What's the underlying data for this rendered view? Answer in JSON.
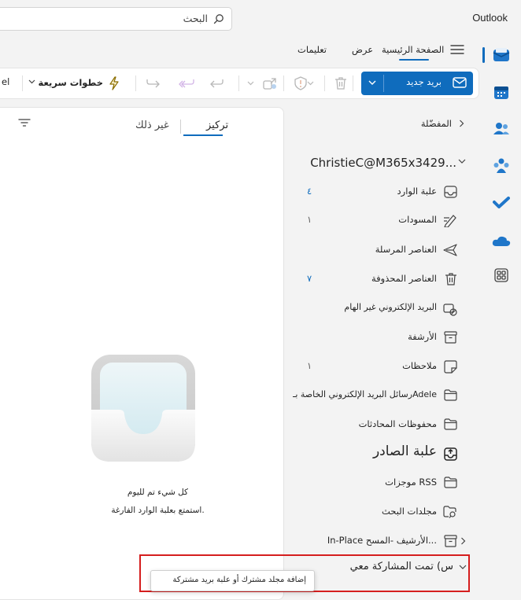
{
  "titlebar": {
    "app_title": "Outlook",
    "search_placeholder": "البحث"
  },
  "ribbon": {
    "tabs": [
      {
        "label": "الصفحة الرئيسية",
        "active": true
      },
      {
        "label": "عرض",
        "active": false
      },
      {
        "label": "تعليمات",
        "active": false
      }
    ]
  },
  "commands": {
    "new_mail_label": "بريد جديد",
    "quick_steps_label": "خطوات سريعة",
    "truncated_label": "el"
  },
  "folders": {
    "favorites_label": "المفضّلة",
    "account_label": "ChristieC@M365x3429...",
    "items": [
      {
        "label": "علبة الوارد",
        "count": "٤",
        "icon": "inbox-icon"
      },
      {
        "label": "المسودات",
        "count": "١",
        "icon": "drafts-icon"
      },
      {
        "label": "العناصر المرسلة",
        "count": "",
        "icon": "sent-icon"
      },
      {
        "label": "العناصر المحذوفة",
        "count": "٧",
        "icon": "trash-icon"
      },
      {
        "label": "البريد الإلكتروني غير الهام",
        "count": "",
        "icon": "junk-icon"
      },
      {
        "label": "الأرشفة",
        "count": "",
        "icon": "archive-icon"
      },
      {
        "label": "ملاحظات",
        "count": "١",
        "icon": "notes-icon"
      },
      {
        "label": "رسائل البريد الإلكتروني الخاصة بـAdele",
        "count": "",
        "icon": "folder-icon"
      },
      {
        "label": "محفوظات المحادثات",
        "count": "",
        "icon": "folder-icon"
      },
      {
        "label": "علبة الصادر",
        "count": "",
        "icon": "outbox-icon"
      },
      {
        "label": "موجزات RSS",
        "count": "",
        "icon": "folder-icon"
      },
      {
        "label": "مجلدات البحث",
        "count": "",
        "icon": "search-folder-icon"
      },
      {
        "label": "In-Place الأرشيف -المسح...",
        "count": "",
        "icon": "archive-icon"
      }
    ],
    "shared_label": "س) تمت المشاركة معي"
  },
  "message_list": {
    "tab_focused": "تركيز",
    "tab_other": "غير ذلك",
    "empty_title": "كل شيء تم لليوم",
    "empty_subtitle": "استمتع بعلبة الوارد الفارغة."
  },
  "tooltip": {
    "text": "إضافة مجلد مشترك أو علبة بريد مشتركة"
  },
  "colors": {
    "accent": "#0f6cbd",
    "highlight": "#d51e1e",
    "count_color": "#0f6cbd"
  }
}
